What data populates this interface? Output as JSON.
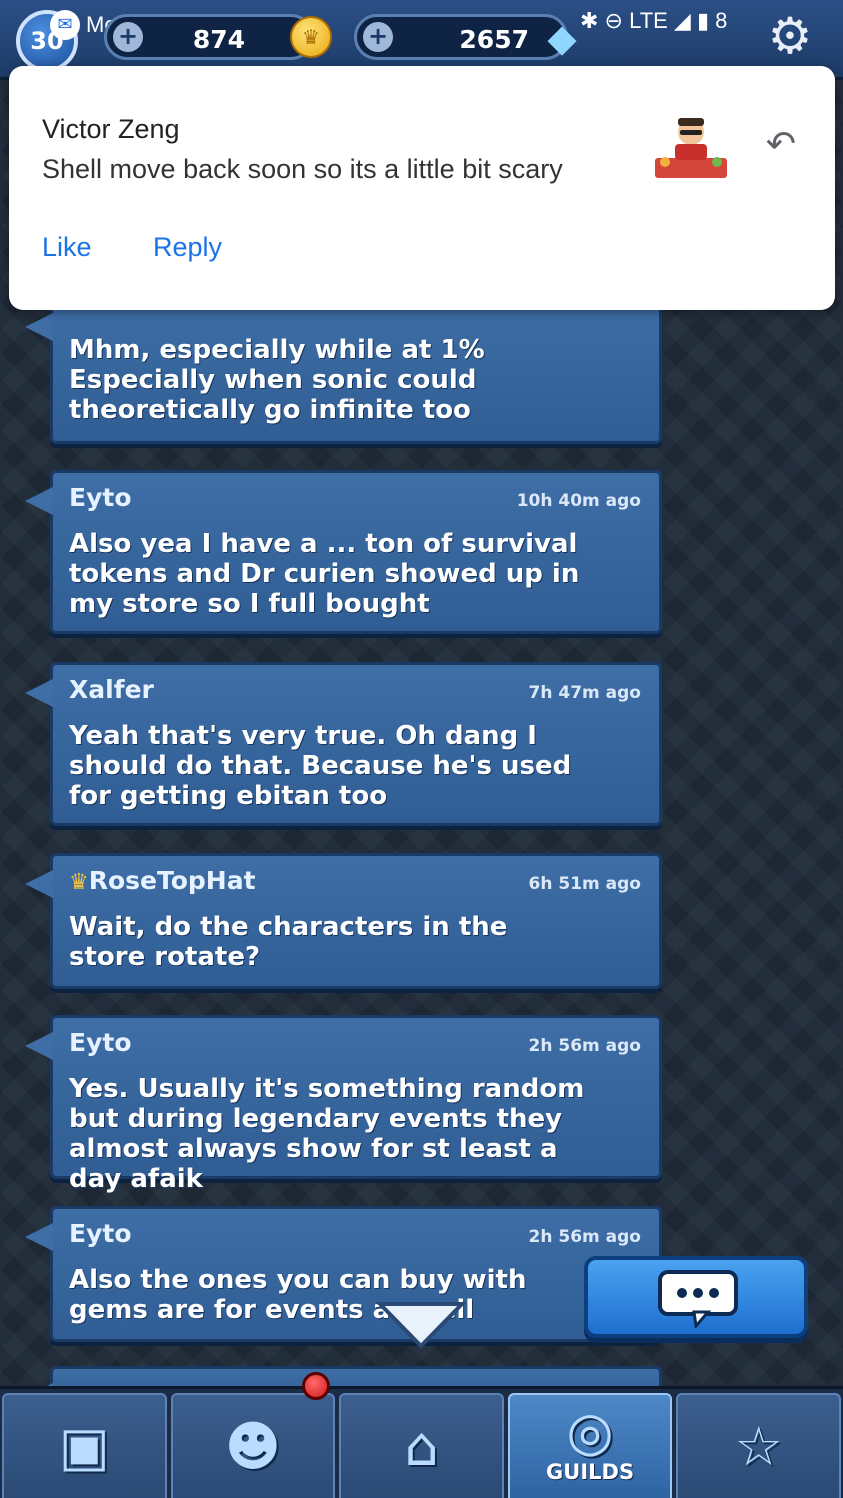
{
  "topbar": {
    "level": "30",
    "app_title": "Messenger Lite",
    "coins": "874",
    "gems": "2657",
    "status_text": "✱ ⊖ LTE ◢ ▮ 8"
  },
  "notification": {
    "sender": "Victor Zeng",
    "message": "Shell move back soon so its a little bit scary",
    "like_label": "Like",
    "reply_label": "Reply"
  },
  "messages": [
    {
      "author": "",
      "time": "",
      "text": "Mhm, especially while at 1% Especially when sonic could theoretically go infinite too"
    },
    {
      "author": "Eyto",
      "time": "10h 40m ago",
      "text": "Also yea I have a ... ton of survival tokens and Dr curien showed up in my store so I full bought"
    },
    {
      "author": "Xalfer",
      "time": "7h 47m ago",
      "text": "Yeah that's very true. Oh dang I should do that. Because he's used for getting ebitan too"
    },
    {
      "author": "RoseTopHat",
      "time": "6h 51m ago",
      "text": "Wait, do the characters in the store rotate?"
    },
    {
      "author": "Eyto",
      "time": "2h 56m ago",
      "text": "Yes. Usually it's something random but during legendary events they almost always show for st least a day afaik"
    },
    {
      "author": "Eyto",
      "time": "2h 56m ago",
      "text": "Also the ones you can buy with gems are for events as well"
    }
  ],
  "nav": {
    "guilds_label": "GUILDS"
  },
  "colors": {
    "bubble": "#3f6ea6",
    "link": "#1a73e8",
    "accent": "#4aa2f0"
  }
}
